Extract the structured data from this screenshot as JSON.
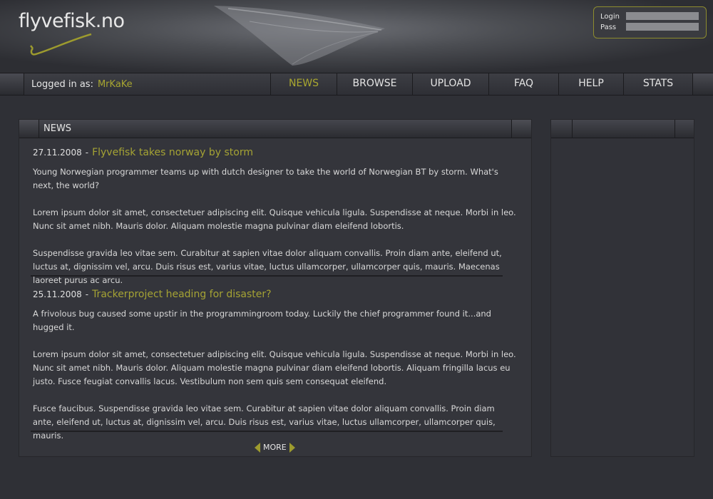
{
  "site": {
    "logo_text": "flyvefisk.no"
  },
  "login": {
    "login_label": "Login",
    "pass_label": "Pass"
  },
  "nav": {
    "logged_in_label": "Logged in as:",
    "username": "MrKaKe",
    "items": [
      {
        "label": "NEWS",
        "active": true
      },
      {
        "label": "BROWSE",
        "active": false
      },
      {
        "label": "UPLOAD",
        "active": false
      },
      {
        "label": "FAQ",
        "active": false
      },
      {
        "label": "HELP",
        "active": false
      },
      {
        "label": "STATS",
        "active": false
      }
    ]
  },
  "news": {
    "panel_title": "NEWS",
    "articles": [
      {
        "date": "27.11.2008",
        "title": "Flyvefisk takes norway by storm",
        "paragraphs": [
          "Young  Norwegian programmer teams up with dutch designer to take the world of Norwegian BT by storm. What's next, the world?",
          "Lorem ipsum dolor sit amet, consectetuer adipiscing elit. Quisque vehicula ligula. Suspendisse at neque. Morbi in leo. Nunc sit amet nibh. Mauris dolor. Aliquam molestie magna pulvinar diam eleifend lobortis.",
          "Suspendisse gravida leo vitae sem. Curabitur at sapien vitae dolor aliquam convallis. Proin diam ante, eleifend ut, luctus at, dignissim vel, arcu. Duis risus est, varius vitae, luctus ullamcorper, ullamcorper quis, mauris. Maecenas laoreet purus ac arcu."
        ]
      },
      {
        "date": "25.11.2008",
        "title": "Trackerproject heading for disaster?",
        "paragraphs": [
          "A frivolous bug caused some upstir in the programmingroom today. Luckily the chief programmer found it...and hugged it.",
          "Lorem ipsum dolor sit amet, consectetuer adipiscing elit. Quisque vehicula ligula. Suspendisse at neque. Morbi in leo. Nunc sit amet nibh. Mauris dolor. Aliquam molestie magna pulvinar diam eleifend lobortis. Aliquam fringilla lacus eu justo. Fusce feugiat convallis lacus. Vestibulum non sem quis sem consequat eleifend.",
          "Fusce faucibus. Suspendisse gravida leo vitae sem. Curabitur at sapien vitae dolor aliquam convallis. Proin diam ante, eleifend ut, luctus at, dignissim vel, arcu. Duis risus est, varius vitae, luctus ullamcorper, ullamcorper quis, mauris."
        ]
      }
    ],
    "more_label": "MORE"
  },
  "colors": {
    "accent": "#a7a531",
    "background": "#2f3036"
  }
}
